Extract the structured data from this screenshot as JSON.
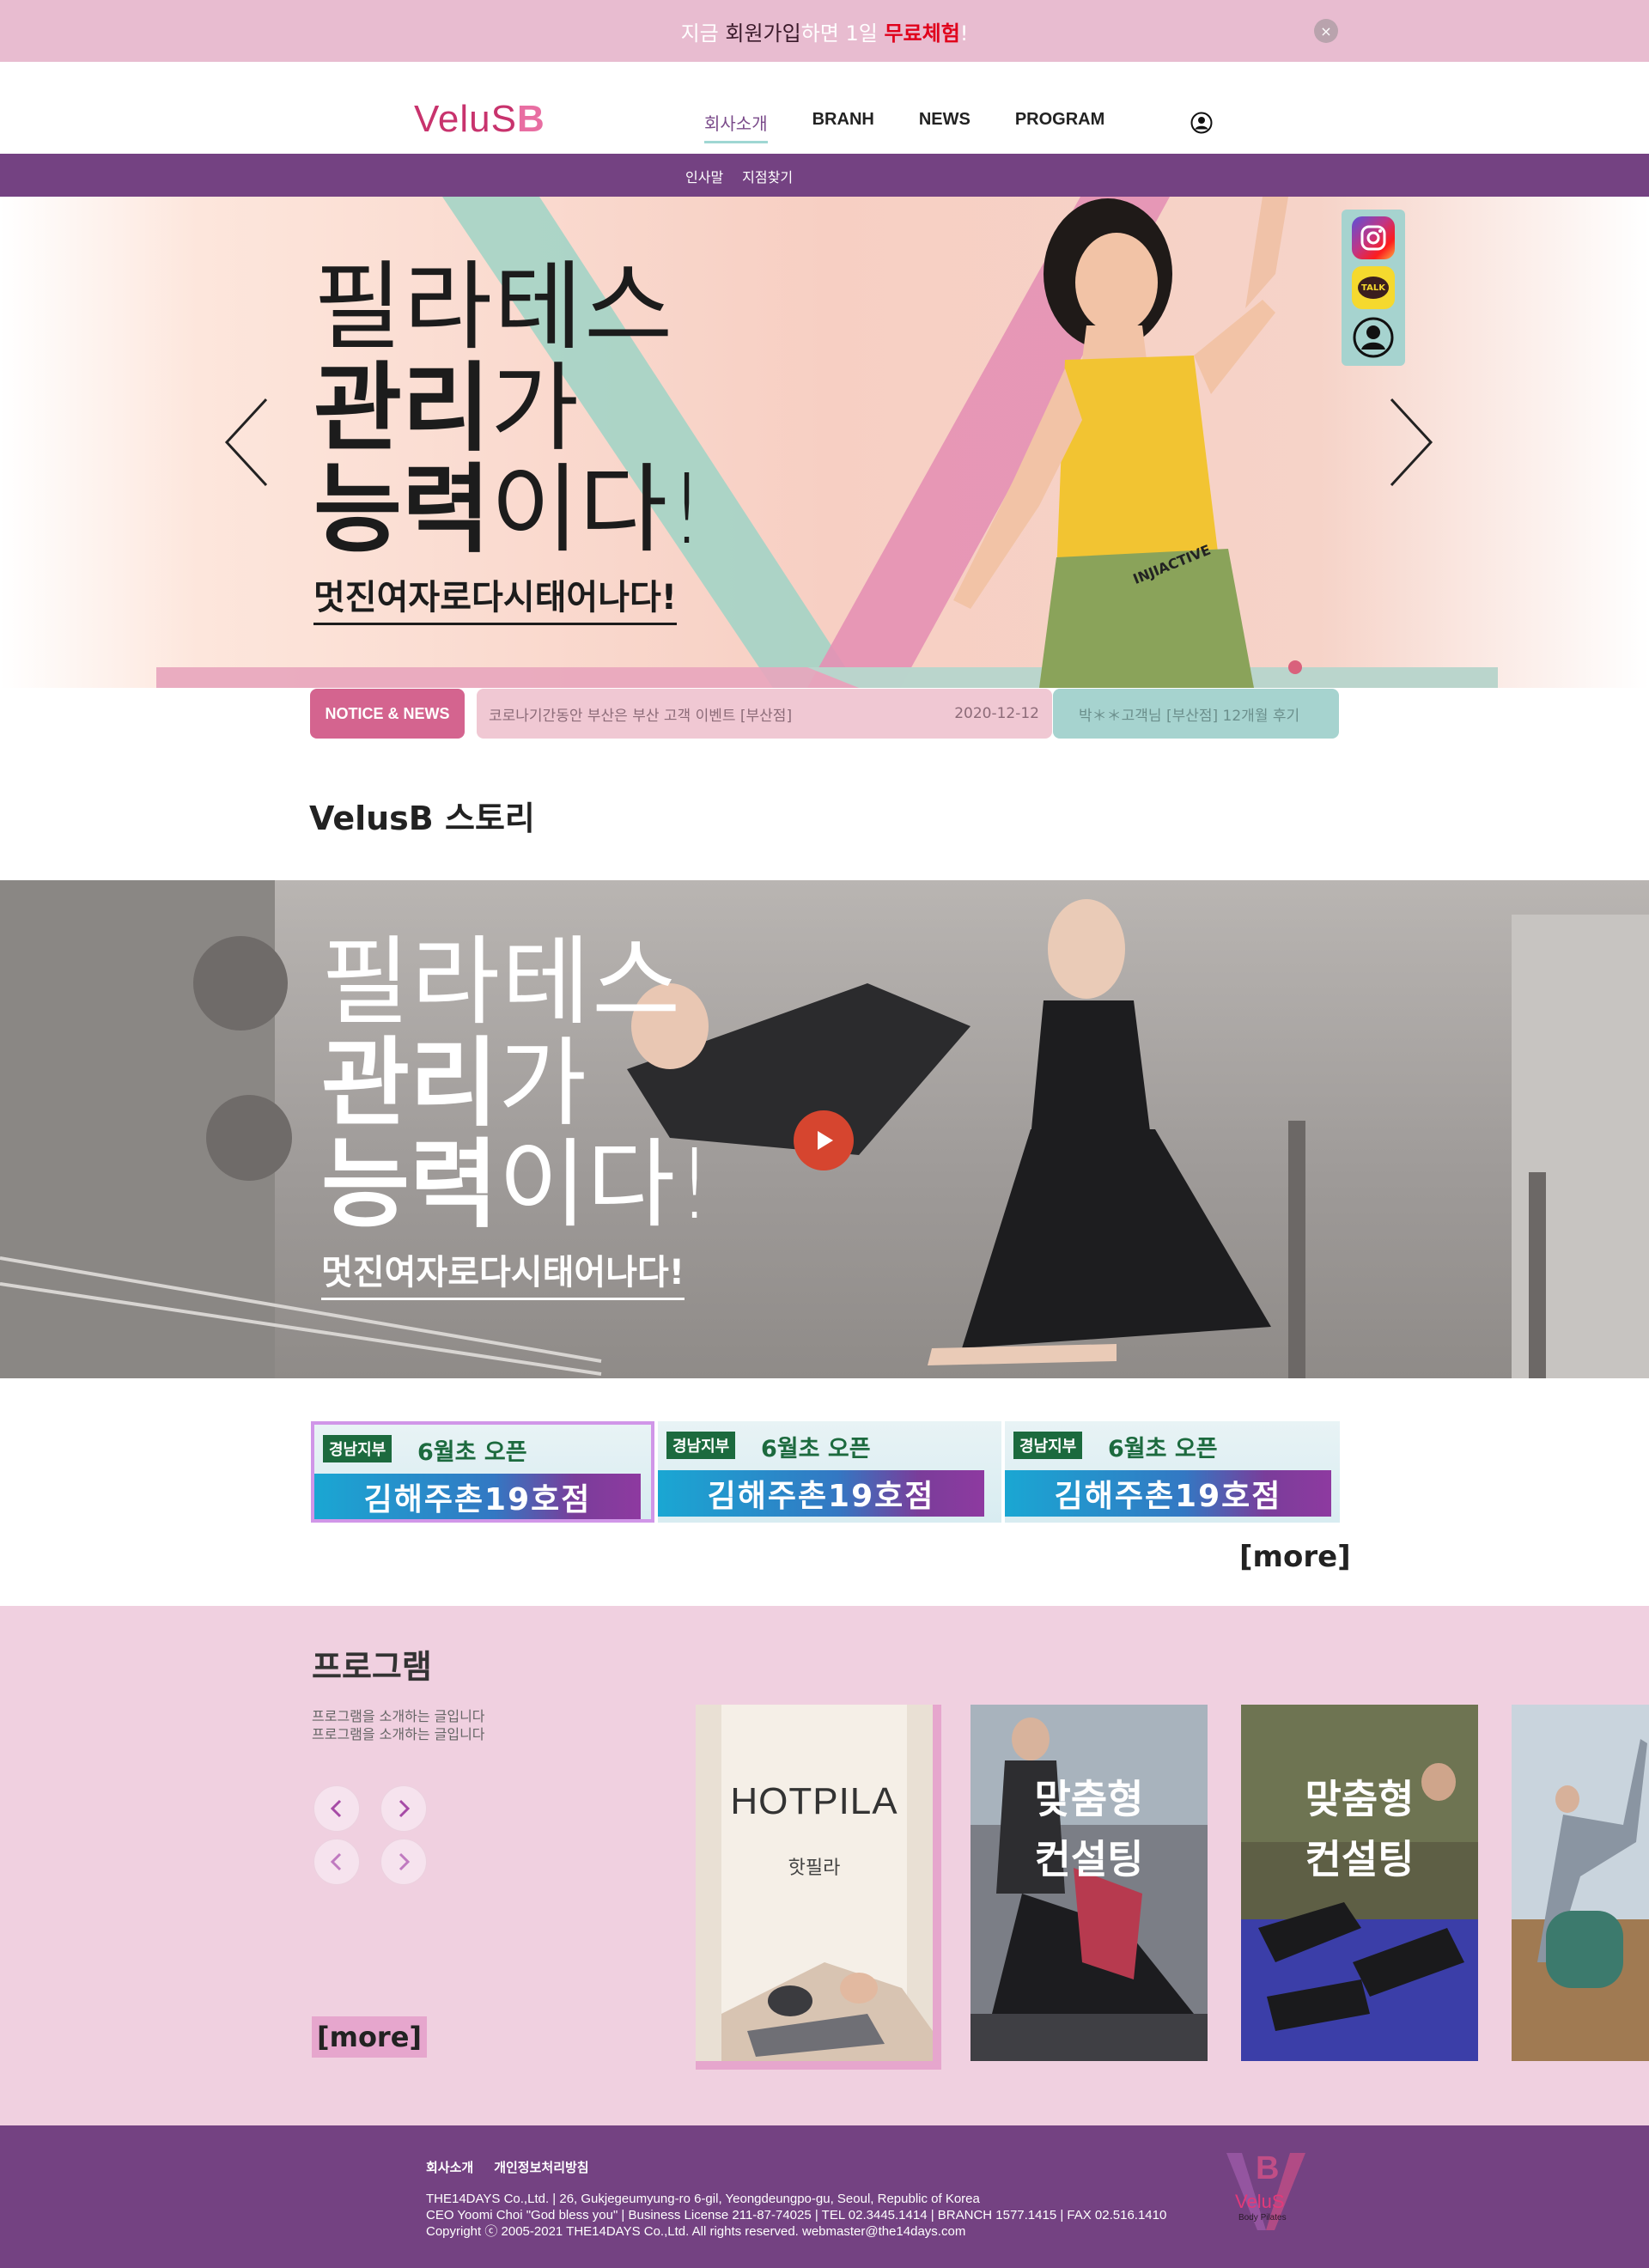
{
  "promo": {
    "part1": "지금 ",
    "part2": "회원가입",
    "part3": "하면 1일 ",
    "part4": "무료체험",
    "part5": "!",
    "close_symbol": "×"
  },
  "header": {
    "logo_text": "VeluS",
    "logo_b": "B",
    "nav": [
      "회사소개",
      "BRANH",
      "NEWS",
      "PROGRAM"
    ],
    "subnav": [
      "인사말",
      "지점찾기"
    ]
  },
  "hero": {
    "line1": "필라테스",
    "line2_bold": "관리",
    "line2_light": "가",
    "line3_bold": "능력",
    "line3_light": "이다!",
    "sub": "멋진여자로다시태어나다!",
    "shirt_text": "INJIACTIVE"
  },
  "social": {
    "kakao_label": "TALK"
  },
  "notice": {
    "label": "NOTICE & NEWS",
    "item_title": "코로나기간동안 부산은 부산 고객 이벤트 [부산점]",
    "item_date": "2020-12-12",
    "item2_title": "박＊＊고객님 [부산점] 12개월 후기"
  },
  "story": {
    "title": "VelusB 스토리",
    "video_line1": "필라테스",
    "video_line2_bold": "관리",
    "video_line2_light": "가",
    "video_line3_bold": "능력",
    "video_line3_light": "이다!",
    "video_sub": "멋진여자로다시태어나다!"
  },
  "branches": [
    {
      "tag": "경남지부",
      "open": "6월초 오픈",
      "name": "김해주촌19호점"
    },
    {
      "tag": "경남지부",
      "open": "6월초 오픈",
      "name": "김해주촌19호점"
    },
    {
      "tag": "경남지부",
      "open": "6월초 오픈",
      "name": "김해주촌19호점"
    }
  ],
  "more_label": "[more]",
  "program": {
    "title": "프로그램",
    "desc1": "프로그램을 소개하는 글입니다",
    "desc2": "프로그램을 소개하는 글입니다",
    "more_label": "[more]",
    "cards": [
      {
        "title": "HOTPILA",
        "sub": "핫필라"
      },
      {
        "title1": "맞춤형",
        "title2": "컨설팅"
      },
      {
        "title1": "맞춤형",
        "title2": "컨설팅"
      }
    ]
  },
  "footer": {
    "links": [
      "회사소개",
      "개인정보처리방침"
    ],
    "line1": "THE14DAYS Co.,Ltd. | 26, Gukjegeumyung-ro 6-gil, Yeongdeungpo-gu, Seoul, Republic of Korea",
    "line2": "CEO Yoomi Choi \"God bless you\" | Business License 211-87-74025 | TEL 02.3445.1414 | BRANCH 1577.1415 | FAX 02.516.1410",
    "line3": "Copyright ⓒ 2005-2021 THE14DAYS Co.,Ltd. All rights reserved. webmaster@the14days.com",
    "logo_main": "VeluS",
    "logo_sub": "Body Pilates"
  },
  "colors": {
    "brand_purple": "#744282",
    "brand_pink": "#d4648f",
    "mint": "#a6d3cf",
    "promo_bg": "#e8bcd0",
    "program_bg": "#f0d0e0"
  }
}
